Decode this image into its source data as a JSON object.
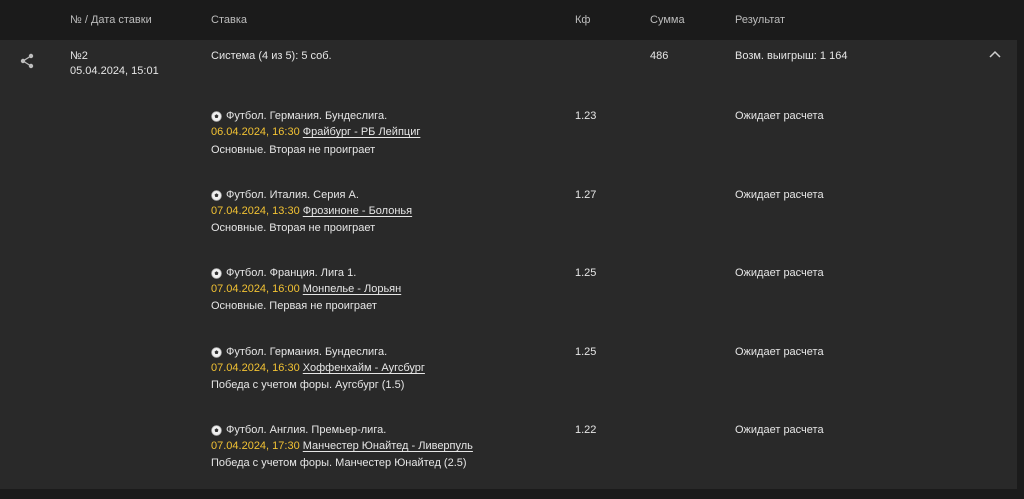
{
  "header": {
    "col_number": "№ / Дата ставки",
    "col_bet": "Ставка",
    "col_coef": "Кф",
    "col_sum": "Сумма",
    "col_result": "Результат"
  },
  "bet": {
    "number": "№2",
    "date": "05.04.2024, 15:01",
    "type": "Система (4 из 5): 5 соб.",
    "sum": "486",
    "possible_win": "Возм. выигрыш: 1 164"
  },
  "events": [
    {
      "league": "Футбол. Германия. Бундеслига.",
      "datetime": "06.04.2024, 16:30",
      "match": "Фрайбург - РБ Лейпциг",
      "market": "Основные. Вторая не проиграет",
      "coef": "1.23",
      "status": "Ожидает расчета"
    },
    {
      "league": "Футбол. Италия. Серия А.",
      "datetime": "07.04.2024, 13:30",
      "match": "Фрозиноне - Болонья",
      "market": "Основные. Вторая не проиграет",
      "coef": "1.27",
      "status": "Ожидает расчета"
    },
    {
      "league": "Футбол. Франция. Лига 1.",
      "datetime": "07.04.2024, 16:00",
      "match": "Монпелье - Лорьян",
      "market": "Основные. Первая не проиграет",
      "coef": "1.25",
      "status": "Ожидает расчета"
    },
    {
      "league": "Футбол. Германия. Бундеслига.",
      "datetime": "07.04.2024, 16:30",
      "match": "Хоффенхайм - Аугсбург",
      "market": "Победа с учетом форы. Аугсбург (1.5)",
      "coef": "1.25",
      "status": "Ожидает расчета"
    },
    {
      "league": "Футбол. Англия. Премьер-лига.",
      "datetime": "07.04.2024, 17:30",
      "match": "Манчестер Юнайтед - Ливерпуль",
      "market": "Победа с учетом форы. Манчестер Юнайтед (2.5)",
      "coef": "1.22",
      "status": "Ожидает расчета"
    }
  ],
  "icons": {
    "share": "share-icon",
    "collapse": "chevron-up-icon",
    "sport": "soccer-ball-icon"
  },
  "colors": {
    "date_accent": "#f2c233",
    "panel_bg": "#292929",
    "page_bg": "#1b1b1b"
  }
}
